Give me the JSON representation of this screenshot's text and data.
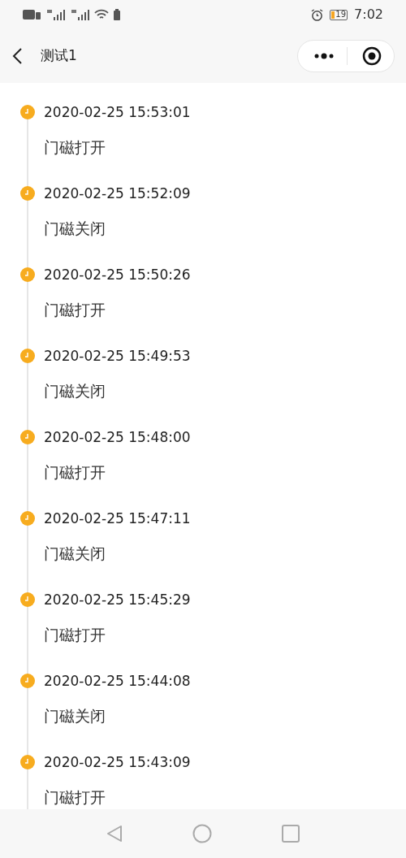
{
  "status_bar": {
    "battery": "19",
    "time": "7:02"
  },
  "header": {
    "title": "测试1"
  },
  "events": [
    {
      "time": "2020-02-25 15:53:01",
      "label": "门磁打开"
    },
    {
      "time": "2020-02-25 15:52:09",
      "label": "门磁关闭"
    },
    {
      "time": "2020-02-25 15:50:26",
      "label": "门磁打开"
    },
    {
      "time": "2020-02-25 15:49:53",
      "label": "门磁关闭"
    },
    {
      "time": "2020-02-25 15:48:00",
      "label": "门磁打开"
    },
    {
      "time": "2020-02-25 15:47:11",
      "label": "门磁关闭"
    },
    {
      "time": "2020-02-25 15:45:29",
      "label": "门磁打开"
    },
    {
      "time": "2020-02-25 15:44:08",
      "label": "门磁关闭"
    },
    {
      "time": "2020-02-25 15:43:09",
      "label": "门磁打开"
    }
  ]
}
